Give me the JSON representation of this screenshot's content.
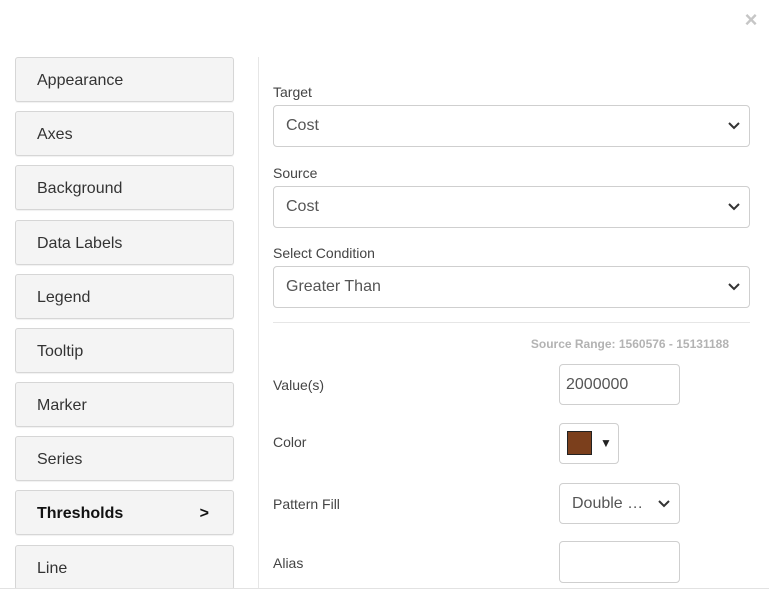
{
  "dialog": {
    "close_label": "×"
  },
  "sidebar": {
    "items": [
      {
        "label": "Appearance",
        "active": false
      },
      {
        "label": "Axes",
        "active": false
      },
      {
        "label": "Background",
        "active": false
      },
      {
        "label": "Data Labels",
        "active": false
      },
      {
        "label": "Legend",
        "active": false
      },
      {
        "label": "Tooltip",
        "active": false
      },
      {
        "label": "Marker",
        "active": false
      },
      {
        "label": "Series",
        "active": false
      },
      {
        "label": "Thresholds",
        "active": true,
        "arrow": ">"
      },
      {
        "label": "Line",
        "active": false
      }
    ]
  },
  "form": {
    "target": {
      "label": "Target",
      "value": "Cost"
    },
    "source": {
      "label": "Source",
      "value": "Cost"
    },
    "condition": {
      "label": "Select Condition",
      "value": "Greater Than"
    },
    "source_range": "Source Range: 1560576 - 15131188",
    "values": {
      "label": "Value(s)",
      "value": "2000000"
    },
    "color": {
      "label": "Color",
      "value": "#7b3f1c",
      "caret": "▼"
    },
    "pattern_fill": {
      "label": "Pattern Fill",
      "value": "Double …"
    },
    "alias": {
      "label": "Alias",
      "value": ""
    }
  }
}
